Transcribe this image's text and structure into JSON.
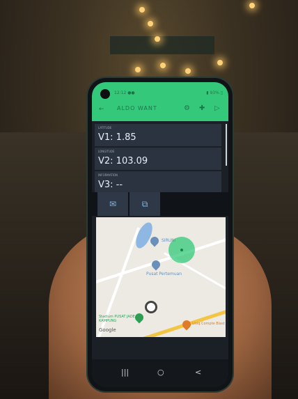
{
  "app": {
    "title": "ALDO WANT",
    "status_left": "12:12 ●●",
    "status_right": "▮ 93% ▯"
  },
  "displays": [
    {
      "label": "LATITUDE",
      "value": "V1: 1.85"
    },
    {
      "label": "LONGITUDE",
      "value": "V2: 103.09"
    },
    {
      "label": "INFORMATION",
      "value": "V3: --"
    }
  ],
  "tabs": {
    "left_icon": "mail-icon",
    "right_icon": "map-tab-icon"
  },
  "map": {
    "labels": {
      "place1": "SIRUNI",
      "place2": "Pusat Pertemuan",
      "place3": "Stadium PUSAT JADE KAMPUNG",
      "place4": "Uniq Compte Blast",
      "brand": "Google"
    },
    "colors": {
      "radius": "#34c97a",
      "road_yellow": "#f4c542",
      "water": "#8fb7e3"
    }
  },
  "navbar": {
    "recent": "|||",
    "home": "○",
    "back": "<"
  },
  "accent": "#34c97a"
}
